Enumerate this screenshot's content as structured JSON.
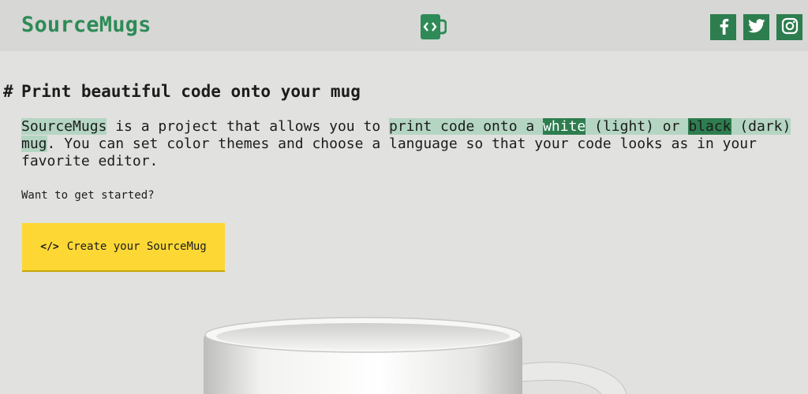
{
  "header": {
    "brand": "SourceMugs",
    "logo_icon": "code-mug-logo",
    "socials": [
      {
        "name": "facebook",
        "icon": "facebook-icon"
      },
      {
        "name": "twitter",
        "icon": "twitter-icon"
      },
      {
        "name": "instagram",
        "icon": "instagram-icon"
      }
    ]
  },
  "main": {
    "heading_prefix": "#",
    "heading": "Print beautiful code onto your mug",
    "intro": {
      "brand": "SourceMugs",
      "t1": " is a project that allows you to ",
      "phrase1": "print code onto a ",
      "white": "white",
      "t2": " (light) or ",
      "black": "black",
      "t3": " (dark)",
      "mug": "mug",
      "t4": ". You can set color themes and choose a language so that your code looks as in your favorite editor."
    },
    "question": "Want to get started?",
    "cta": {
      "icon": "</>",
      "label": "Create your SourceMug"
    }
  },
  "colors": {
    "accent": "#2e8b57",
    "accent_dark": "#2e7d4f",
    "highlight": "#b4d5c2",
    "cta": "#fdd835",
    "background": "#e1e1df",
    "header_bg": "#d7d7d5"
  }
}
